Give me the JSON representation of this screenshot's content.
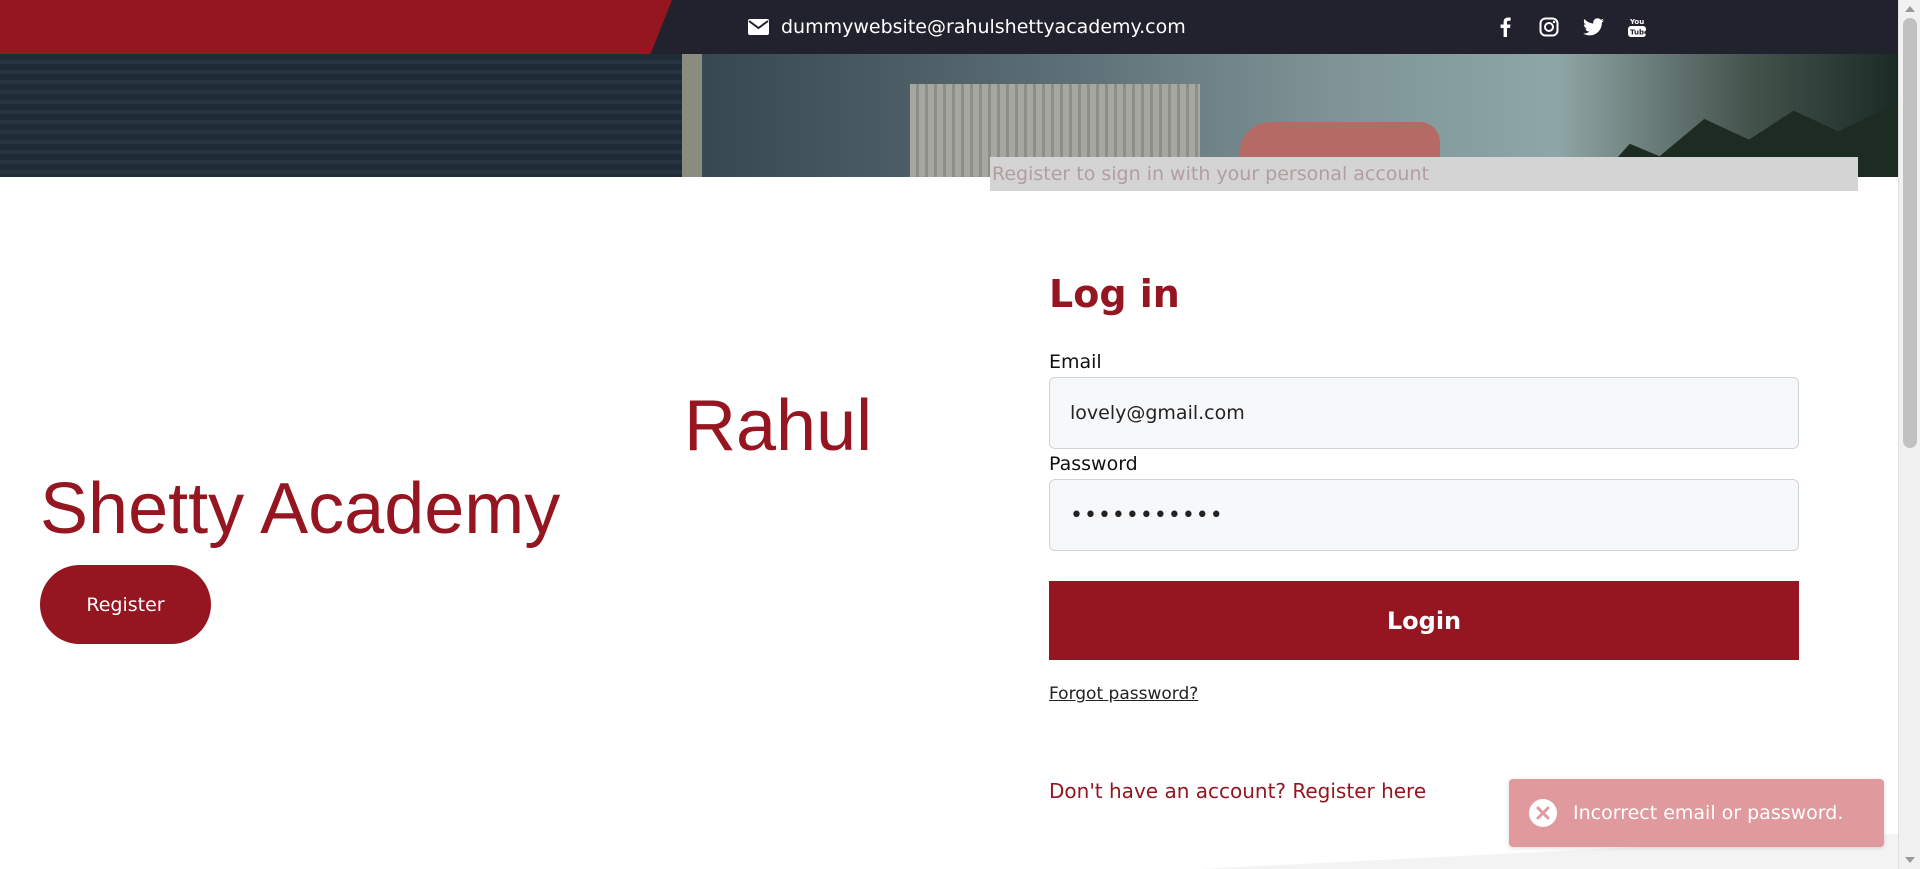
{
  "header": {
    "contact_email": "dummywebsite@rahulshettyacademy.com",
    "icons": [
      "envelope-icon",
      "facebook-icon",
      "instagram-icon",
      "twitter-icon",
      "youtube-icon"
    ]
  },
  "hero": {
    "register_hint": "Register to sign in with your personal account"
  },
  "brand": {
    "line1": "Rahul",
    "line2": "Shetty Academy",
    "register_button": "Register"
  },
  "login": {
    "title": "Log in",
    "email_label": "Email",
    "email_value": "lovely@gmail.com",
    "password_label": "Password",
    "password_value": "Lovely@1234",
    "login_button": "Login",
    "forgot_link": "Forgot password?",
    "signup_link": "Don't have an account? Register here"
  },
  "toast": {
    "message": "Incorrect email or password.",
    "icon": "error-x-icon"
  },
  "colors": {
    "brand_red": "#951520",
    "topbar_dark": "#22222e",
    "toast_bg": "#e09a9d"
  }
}
